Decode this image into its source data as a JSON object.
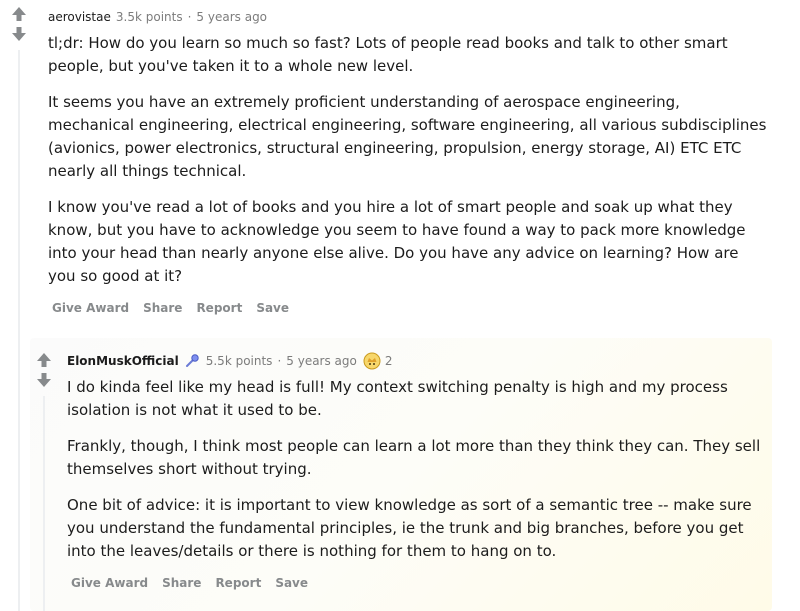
{
  "comment1": {
    "author": "aerovistae",
    "points": "3.5k points",
    "separator": "·",
    "time": "5 years ago",
    "paragraphs": [
      "tl;dr: How do you learn so much so fast? Lots of people read books and talk to other smart people, but you've taken it to a whole new level.",
      "It seems you have an extremely proficient understanding of aerospace engineering, mechanical engineering, electrical engineering, software engineering, all various subdisciplines (avionics, power electronics, structural engineering, propulsion, energy storage, AI) ETC ETC nearly all things technical.",
      "I know you've read a lot of books and you hire a lot of smart people and soak up what they know, but you have to acknowledge you seem to have found a way to pack more knowledge into your head than nearly anyone else alive. Do you have any advice on learning? How are you so good at it?"
    ],
    "actions": [
      "Give Award",
      "Share",
      "Report",
      "Save"
    ]
  },
  "comment2": {
    "author": "ElonMuskOfficial",
    "flair_icon": "microphone-icon",
    "points": "5.5k points",
    "separator": "·",
    "time": "5 years ago",
    "award_icon": "award-icon",
    "award_count": "2",
    "paragraphs": [
      "I do kinda feel like my head is full! My context switching penalty is high and my process isolation is not what it used to be.",
      "Frankly, though, I think most people can learn a lot more than they think they can. They sell themselves short without trying.",
      "One bit of advice: it is important to view knowledge as sort of a semantic tree -- make sure you understand the fundamental principles, ie the trunk and big branches, before you get into the leaves/details or there is nothing for them to hang on to."
    ],
    "actions": [
      "Give Award",
      "Share",
      "Report",
      "Save"
    ]
  },
  "colors": {
    "vote_arrow": "#878a8c",
    "meta_text": "#7c7c7c",
    "body_text": "#1c1c1c",
    "action_text": "#878a8c",
    "thread_line": "#edeff1"
  }
}
